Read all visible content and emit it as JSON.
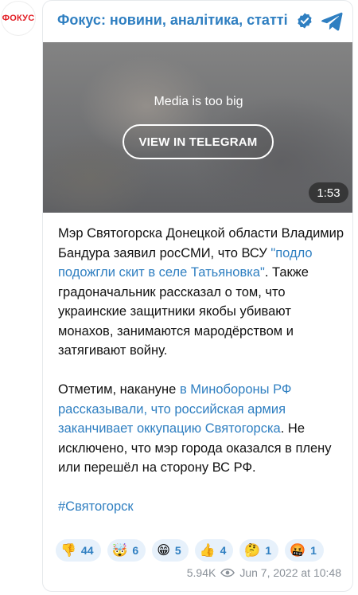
{
  "channel": {
    "avatar_text": "ФОКУС",
    "title": "Фокус: новини, аналітика, статті"
  },
  "media": {
    "notice": "Media is too big",
    "button_label": "VIEW IN TELEGRAM",
    "duration": "1:53"
  },
  "message": {
    "p1_a": "Мэр Святогорска Донецкой области Владимир Бандура заявил росСМИ, что ВСУ ",
    "p1_link": "\"подло подожгли скит в селе Татьяновка\"",
    "p1_b": ". Также градоначальник рассказал о том, что украинские защитники якобы убивают монахов, занимаются мародёрством и затягивают войну.",
    "p2_a": "Отметим, накануне ",
    "p2_link": "в Минобороны РФ рассказывали, что российская армия заканчивает оккупацию Святогорска",
    "p2_b": ". Не исключено, что мэр города оказался в плену или перешёл на сторону ВС РФ.",
    "hashtag": "#Святогорск"
  },
  "reactions": [
    {
      "emoji": "👎",
      "icon": "thumbs-down-icon",
      "count": "44"
    },
    {
      "emoji": "🤯",
      "icon": "exploding-head-icon",
      "count": "6"
    },
    {
      "emoji": "😁",
      "icon": "grinning-face-icon",
      "count": "5"
    },
    {
      "emoji": "👍",
      "icon": "thumbs-up-icon",
      "count": "4"
    },
    {
      "emoji": "🤔",
      "icon": "thinking-face-icon",
      "count": "1"
    },
    {
      "emoji": "🤬",
      "icon": "cursing-face-icon",
      "count": "1"
    }
  ],
  "footer": {
    "views": "5.94K",
    "date": "Jun 7, 2022 at 10:48"
  },
  "colors": {
    "link": "#2f7fc1",
    "brand_red": "#e21d24",
    "reaction_bg": "#e7f1fb",
    "meta_gray": "#8a9199"
  }
}
